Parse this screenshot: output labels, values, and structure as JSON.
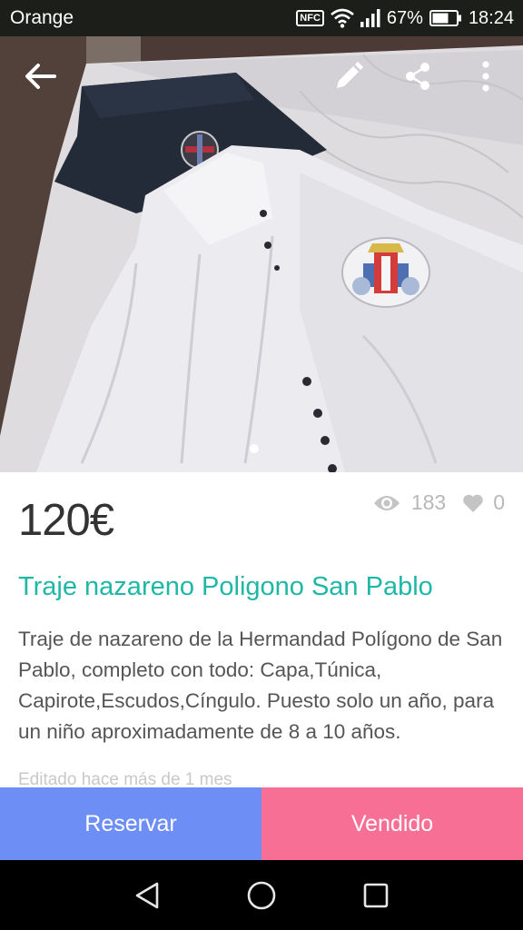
{
  "status_bar": {
    "carrier": "Orange",
    "nfc_label": "NFC",
    "battery": "67%",
    "time": "18:24",
    "icons": [
      "nfc-icon",
      "wifi-icon",
      "signal-icon",
      "battery-icon"
    ]
  },
  "toolbar": {
    "icons": [
      "back-arrow-icon",
      "edit-pencil-icon",
      "share-icon",
      "more-vertical-icon"
    ]
  },
  "gallery": {
    "page_count": 1,
    "current_page": 1
  },
  "stats": {
    "views": "183",
    "likes": "0"
  },
  "product": {
    "price": "120€",
    "title": "Traje nazareno Poligono San Pablo",
    "description": "Traje de nazareno de la Hermandad Polígono de San Pablo, completo con todo: Capa,Túnica, Capirote,Escudos,Cíngulo. Puesto solo un año, para un niño aproximadamente de 8 a 10 años.",
    "edited": "Editado hace más de 1 mes"
  },
  "actions": {
    "reserve": "Reservar",
    "sold": "Vendido"
  },
  "colors": {
    "title": "#1fb8a6",
    "reserve_button": "#6d8ef5",
    "sold_button": "#f76f94",
    "status_bar": "#1c1e1a"
  },
  "navigation": {
    "icons": [
      "nav-back-icon",
      "nav-home-icon",
      "nav-recents-icon"
    ]
  }
}
